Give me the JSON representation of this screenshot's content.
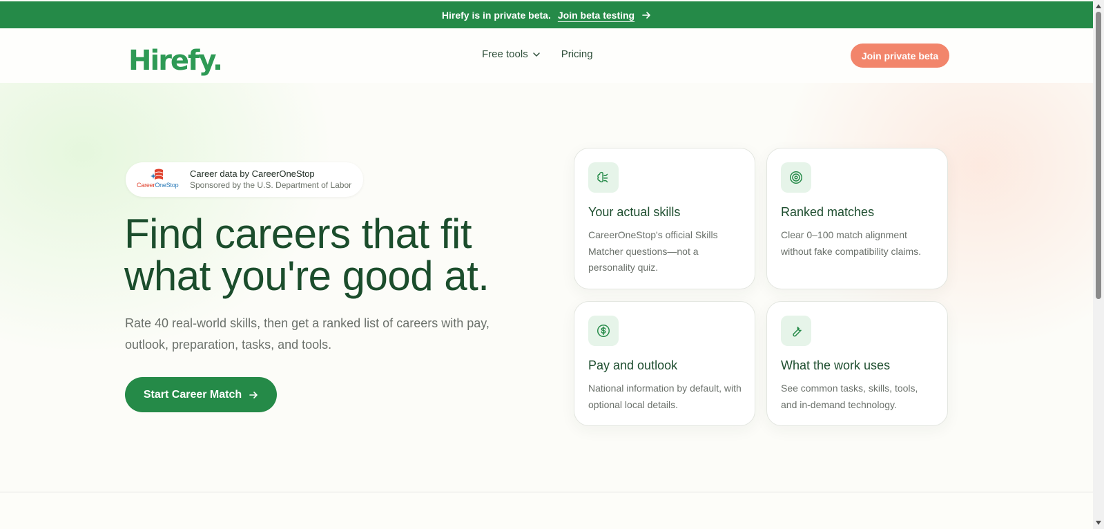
{
  "banner": {
    "message": "Hirefy is in private beta.",
    "link_label": "Join beta testing"
  },
  "header": {
    "logo_text": "Hirefy.",
    "nav": [
      {
        "label": "Free tools",
        "icon": "chevron-down-icon"
      },
      {
        "label": "Pricing"
      }
    ],
    "cta_label": "Join private beta"
  },
  "hero": {
    "source": {
      "logo_text_a": "Career",
      "logo_text_b": "OneStop",
      "title": "Career data by CareerOneStop",
      "subtitle": "Sponsored by the U.S. Department of Labor"
    },
    "headline_line1": "Find careers that fit",
    "headline_line2": "what you're good at.",
    "subtext": "Rate 40 real-world skills, then get a ranked list of careers with pay, outlook, preparation, tasks, and tools.",
    "cta_label": "Start Career Match"
  },
  "features": [
    {
      "icon": "brain-icon",
      "title": "Your actual skills",
      "description": "CareerOneStop's official Skills Matcher questions—not a personality quiz."
    },
    {
      "icon": "target-icon",
      "title": "Ranked matches",
      "description": "Clear 0–100 match alignment without fake compatibility claims."
    },
    {
      "icon": "dollar-icon",
      "title": "Pay and outlook",
      "description": "National information by default, with optional local details."
    },
    {
      "icon": "wrench-icon",
      "title": "What the work uses",
      "description": "See common tasks, skills, tools, and in-demand technology."
    }
  ],
  "colors": {
    "brand_green": "#258a48",
    "accent_coral": "#f2856b",
    "heading_green": "#1b4d2c"
  }
}
